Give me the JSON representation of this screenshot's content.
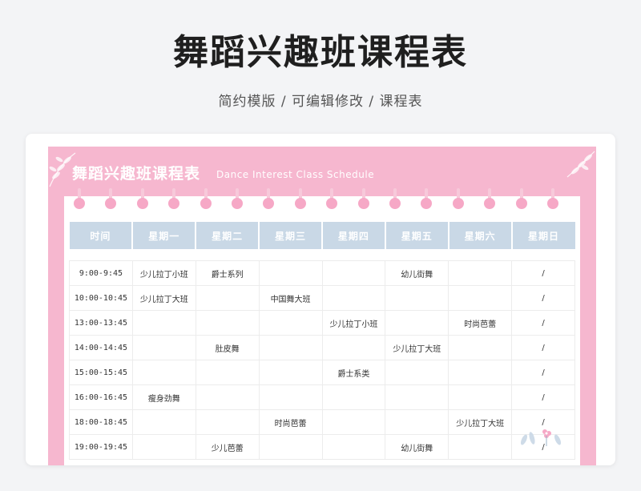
{
  "header": {
    "title": "舞蹈兴趣班课程表",
    "subtitle": "简约模版 / 可编辑修改 / 课程表"
  },
  "sheet": {
    "title": "舞蹈兴趣班课程表",
    "subtitle": "Dance Interest Class Schedule"
  },
  "colors": {
    "accent_pink": "#f6b7cf",
    "header_blue": "#c9d8e6",
    "ring_pink": "#f6a8c6"
  },
  "table": {
    "columns": [
      "时间",
      "星期一",
      "星期二",
      "星期三",
      "星期四",
      "星期五",
      "星期六",
      "星期日"
    ],
    "rows": [
      [
        "9:00-9:45",
        "少儿拉丁小班",
        "爵士系列",
        "",
        "",
        "幼儿街舞",
        "",
        "/"
      ],
      [
        "10:00-10:45",
        "少儿拉丁大班",
        "",
        "中国舞大班",
        "",
        "",
        "",
        "/"
      ],
      [
        "13:00-13:45",
        "",
        "",
        "",
        "少儿拉丁小班",
        "",
        "时尚芭蕾",
        "/"
      ],
      [
        "14:00-14:45",
        "",
        "肚皮舞",
        "",
        "",
        "少儿拉丁大班",
        "",
        "/"
      ],
      [
        "15:00-15:45",
        "",
        "",
        "",
        "爵士系类",
        "",
        "",
        "/"
      ],
      [
        "16:00-16:45",
        "瘦身劲舞",
        "",
        "",
        "",
        "",
        "",
        "/"
      ],
      [
        "18:00-18:45",
        "",
        "",
        "时尚芭蕾",
        "",
        "",
        "少儿拉丁大班",
        "/"
      ],
      [
        "19:00-19:45",
        "",
        "少儿芭蕾",
        "",
        "",
        "幼儿街舞",
        "",
        "/"
      ]
    ]
  }
}
